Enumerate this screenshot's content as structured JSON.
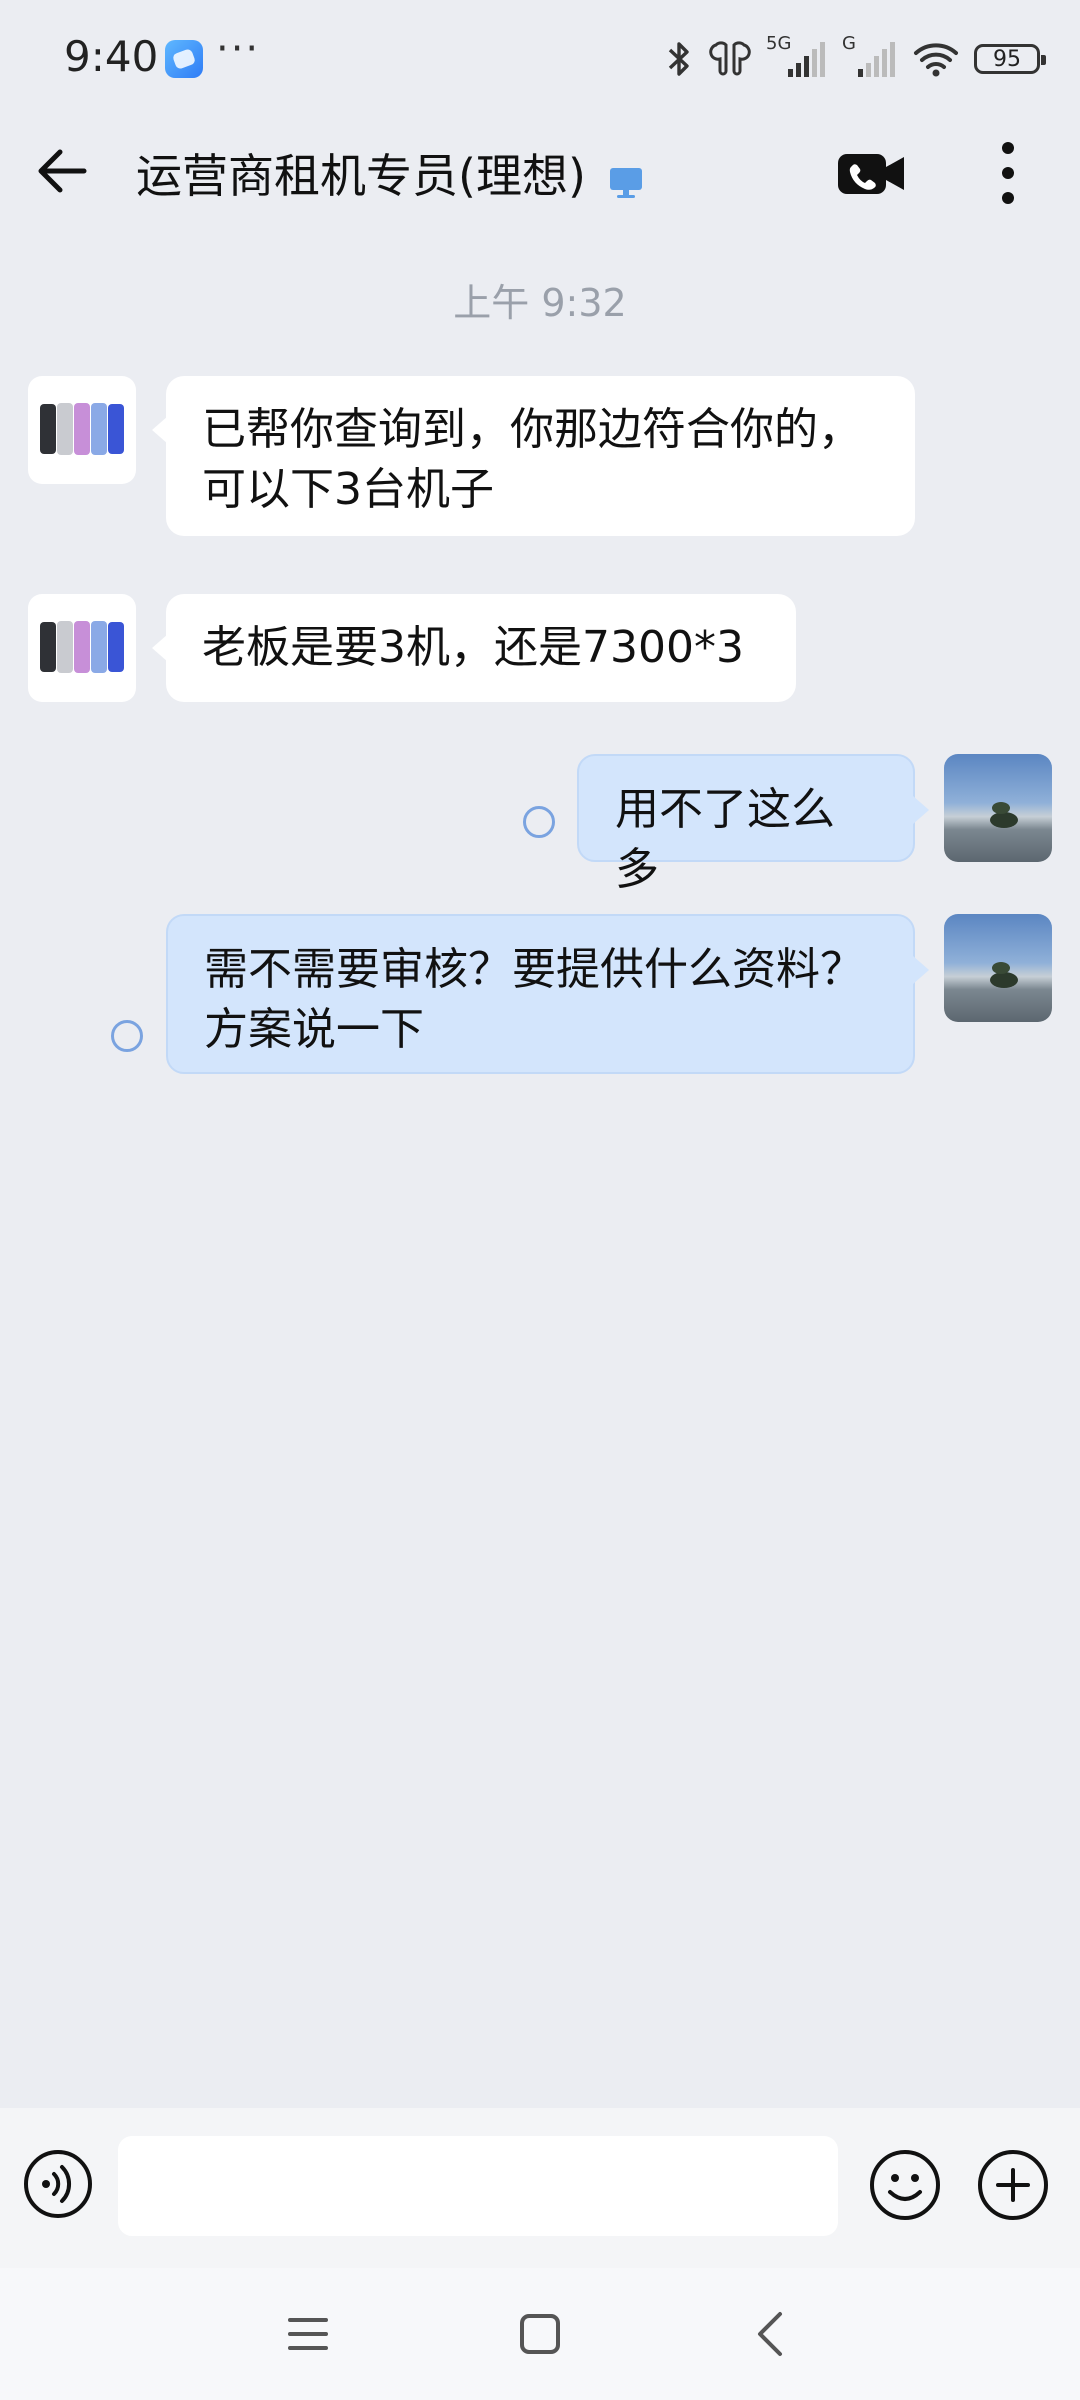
{
  "status_bar": {
    "time": "9:40",
    "dots": "···",
    "network_label_1": "5G",
    "network_label_2": "G",
    "battery": "95",
    "icons": [
      "app-icon",
      "bluetooth-icon",
      "earbuds-icon",
      "signal-icon",
      "wifi-icon",
      "battery-icon"
    ]
  },
  "header": {
    "title": "运营商租机专员(理想)",
    "icons": [
      "back-arrow-icon",
      "computer-icon",
      "video-call-icon",
      "more-vertical-icon"
    ]
  },
  "chat": {
    "timestamp": "上午 9:32",
    "messages": [
      {
        "sender": "contact",
        "text": "已帮你查询到，你那边符合你的，可以下3台机子"
      },
      {
        "sender": "contact",
        "text": "老板是要3机，还是7300*3"
      },
      {
        "sender": "me",
        "text": "用不了这么多"
      },
      {
        "sender": "me",
        "text": "需不需要审核？要提供什么资料？方案说一下"
      }
    ]
  },
  "input_bar": {
    "placeholder": "",
    "icons": [
      "voice-icon",
      "emoji-icon",
      "plus-icon"
    ]
  },
  "nav_bar": {
    "icons": [
      "menu-icon",
      "home-icon",
      "back-icon"
    ]
  },
  "colors": {
    "background": "#ebedf2",
    "incoming_bubble": "#ffffff",
    "outgoing_bubble": "#d3e5fc",
    "read_indicator": "#7aa3e0",
    "timestamp_text": "#9aa0aa"
  }
}
